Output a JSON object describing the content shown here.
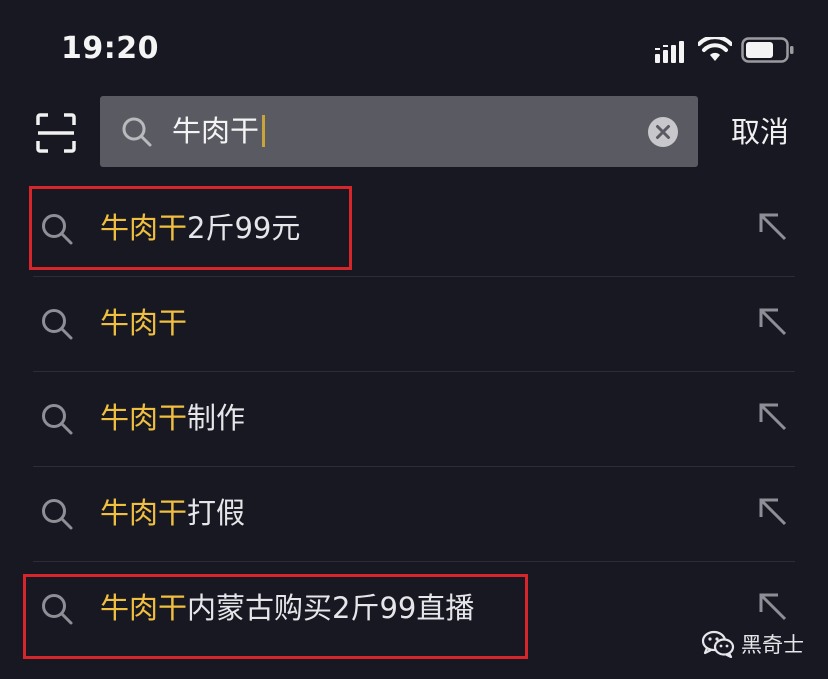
{
  "status_bar": {
    "time": "19:20",
    "icons": [
      "signal-icon",
      "wifi-icon",
      "battery-icon"
    ]
  },
  "search": {
    "query": "牛肉干",
    "cancel_label": "取消"
  },
  "suggestions": [
    {
      "highlight": "牛肉干",
      "rest": "2斤99元",
      "boxed": true
    },
    {
      "highlight": "牛肉干",
      "rest": "",
      "boxed": false
    },
    {
      "highlight": "牛肉干",
      "rest": "制作",
      "boxed": false
    },
    {
      "highlight": "牛肉干",
      "rest": "打假",
      "boxed": false
    },
    {
      "highlight": "牛肉干",
      "rest": "内蒙古购买2斤99直播",
      "boxed": true
    }
  ],
  "watermark": {
    "text": "黑奇士"
  },
  "colors": {
    "background": "#181823",
    "search_box": "#5a5a62",
    "highlight": "#f0bf3f",
    "annotation": "#d6252b",
    "caret": "#c9a43a"
  }
}
